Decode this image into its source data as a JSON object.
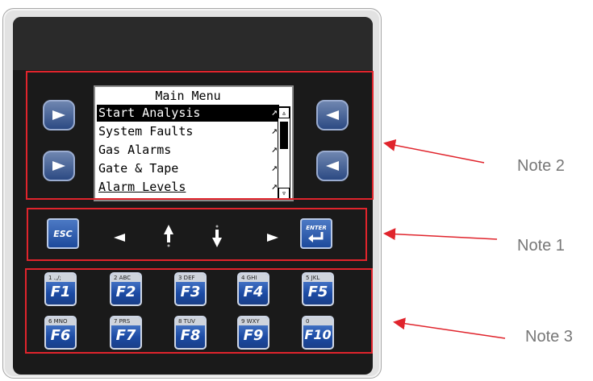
{
  "display": {
    "title": "Main Menu",
    "items": [
      {
        "label": "Start Analysis",
        "arrow": "↗",
        "selected": true
      },
      {
        "label": "System Faults",
        "arrow": "↗"
      },
      {
        "label": "Gas Alarms",
        "arrow": "↗"
      },
      {
        "label": "Gate & Tape",
        "arrow": "↗"
      },
      {
        "label": "Alarm Levels",
        "arrow": "↗"
      }
    ],
    "scroll_up": "▵",
    "scroll_down": "▿"
  },
  "nav_keys": {
    "esc": "ESC",
    "enter": "ENTER"
  },
  "function_keys": [
    {
      "top": "1  .,/;",
      "label": "F1"
    },
    {
      "top": "2  ABC",
      "label": "F2"
    },
    {
      "top": "3  DEF",
      "label": "F3"
    },
    {
      "top": "4  GHI",
      "label": "F4"
    },
    {
      "top": "5  JKL",
      "label": "F5"
    },
    {
      "top": "6  MNO",
      "label": "F6"
    },
    {
      "top": "7  PRS",
      "label": "F7"
    },
    {
      "top": "8  TUV",
      "label": "F8"
    },
    {
      "top": "9  WXY",
      "label": "F9"
    },
    {
      "top": "0",
      "label": "F10"
    }
  ],
  "notes": {
    "note1": "Note 1",
    "note2": "Note 2",
    "note3": "Note 3"
  },
  "colors": {
    "annotation_red": "#e0242c",
    "key_blue": "#1d4a9c"
  }
}
